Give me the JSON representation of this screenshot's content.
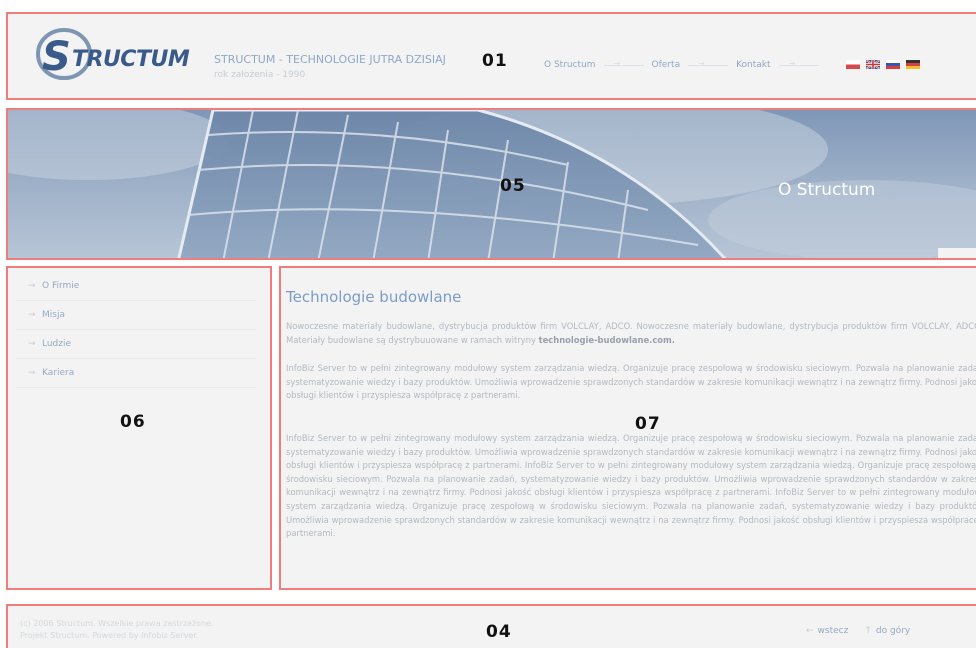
{
  "header": {
    "zone_label": "01",
    "logo_text": "STRUCTUM",
    "title": "STRUCTUM - TECHNOLOGIE JUTRA DZISIAJ",
    "subtitle": "rok założenia - 1990",
    "nav": [
      {
        "label": "O Structum"
      },
      {
        "label": "Oferta"
      },
      {
        "label": "Kontakt"
      }
    ],
    "flags": [
      "pl-flag-icon",
      "uk-flag-icon",
      "ru-flag-icon",
      "de-flag-icon"
    ]
  },
  "banner": {
    "zone_label": "05",
    "title": "O Structum"
  },
  "sidebar": {
    "zone_label": "06",
    "items": [
      {
        "label": "O Firmie"
      },
      {
        "label": "Misja"
      },
      {
        "label": "Ludzie"
      },
      {
        "label": "Kariera"
      }
    ]
  },
  "content": {
    "zone_label": "07",
    "title": "Technologie budowlane",
    "p1_text": "Nowoczesne materiały budowlane, dystrybucja produktów firm VOLCLAY, ADCO. Nowoczesne materiały budowlane, dystrybucja produktów firm VOLCLAY, ADCOS Materiały budowlane są dystrybuuowane w ramach witryny ",
    "p1_link": "technologie-budowlane.com.",
    "p2": "InfoBiz Server to w pełni zintegrowany modułowy system zarządzania wiedzą. Organizuje pracę zespołową w środowisku sieciowym. Pozwala na planowanie zadań, systematyzowanie wiedzy i bazy produktów. Umożliwia wprowadzenie sprawdzonych standardów w zakresie komunikacji wewnątrz i na zewnątrz firmy. Podnosi jakość obsługi klientów i przyspiesza współpracę z partnerami.",
    "p3": "InfoBiz Server to w pełni zintegrowany modułowy system zarządzania wiedzą. Organizuje pracę zespołową w środowisku sieciowym. Pozwala na planowanie zadań, systematyzowanie wiedzy i bazy produktów. Umożliwia wprowadzenie sprawdzonych standardów w zakresie komunikacji wewnątrz i na zewnątrz firmy. Podnosi jakość obsługi klientów i przyspiesza współpracę z partnerami. InfoBiz Server to w pełni zintegrowany modułowy system zarządzania wiedzą. Organizuje pracę zespołową w środowisku sieciowym. Pozwala na planowanie zadań, systematyzowanie wiedzy i bazy produktów. Umożliwia wprowadzenie sprawdzonych standardów w zakresie komunikacji wewnątrz i na zewnątrz firmy. Podnosi jakość obsługi klientów i przyspiesza współpracę z partnerami. InfoBiz Server to w pełni zintegrowany modułowy system zarządzania wiedzą. Organizuje pracę zespołową w środowisku sieciowym. Pozwala na planowanie zadań, systematyzowanie wiedzy i bazy produktów. Umożliwia wprowadzenie sprawdzonych standardów w zakresie komunikacji wewnątrz i na zewnątrz firmy. Podnosi jakość obsługi klientów i przyspiesza współpracę z partnerami."
  },
  "footer": {
    "zone_label": "04",
    "copyright": "(c) 2006 Structum. Wszelkie prawa zastrzeżone.",
    "credits": "Projekt Structum. Powered by Infobiz Server.",
    "back_label": "wstecz",
    "top_label": "do góry"
  },
  "colors": {
    "zone_border": "#f07c7c",
    "panel_bg": "#f3f3f3",
    "link": "#8ea8c8",
    "heading": "#7c9cc8",
    "body_text": "#b2b9c2"
  }
}
